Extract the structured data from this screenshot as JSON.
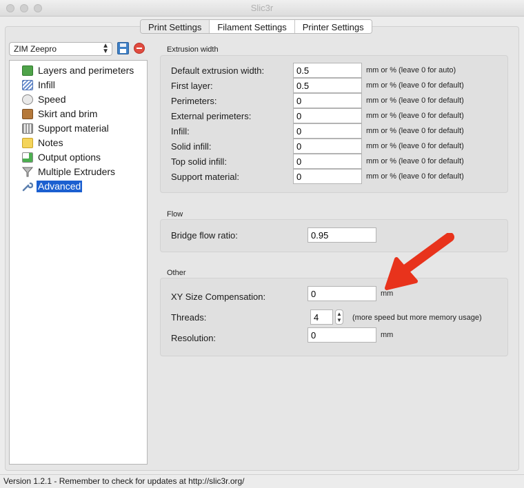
{
  "window": {
    "title": "Slic3r"
  },
  "tabs": [
    {
      "label": "Print Settings",
      "active": true
    },
    {
      "label": "Filament Settings",
      "active": false
    },
    {
      "label": "Printer Settings",
      "active": false
    }
  ],
  "preset": {
    "selected": "ZIM Zeepro"
  },
  "sidebar": {
    "items": [
      {
        "label": "Layers and perimeters",
        "icon": "layers-icon"
      },
      {
        "label": "Infill",
        "icon": "infill-icon"
      },
      {
        "label": "Speed",
        "icon": "speed-icon"
      },
      {
        "label": "Skirt and brim",
        "icon": "skirt-icon"
      },
      {
        "label": "Support material",
        "icon": "support-icon"
      },
      {
        "label": "Notes",
        "icon": "notes-icon"
      },
      {
        "label": "Output options",
        "icon": "output-icon"
      },
      {
        "label": "Multiple Extruders",
        "icon": "funnel-icon"
      },
      {
        "label": "Advanced",
        "icon": "wrench-icon",
        "selected": true
      }
    ]
  },
  "extrusion": {
    "title": "Extrusion width",
    "rows": [
      {
        "label": "Default extrusion width:",
        "value": "0.5",
        "suffix": "mm or % (leave 0 for auto)"
      },
      {
        "label": "First layer:",
        "value": "0.5",
        "suffix": "mm or % (leave 0 for default)"
      },
      {
        "label": "Perimeters:",
        "value": "0",
        "suffix": "mm or % (leave 0 for default)"
      },
      {
        "label": "External perimeters:",
        "value": "0",
        "suffix": "mm or % (leave 0 for default)"
      },
      {
        "label": "Infill:",
        "value": "0",
        "suffix": "mm or % (leave 0 for default)"
      },
      {
        "label": "Solid infill:",
        "value": "0",
        "suffix": "mm or % (leave 0 for default)"
      },
      {
        "label": "Top solid infill:",
        "value": "0",
        "suffix": "mm or % (leave 0 for default)"
      },
      {
        "label": "Support material:",
        "value": "0",
        "suffix": "mm or % (leave 0 for default)"
      }
    ]
  },
  "flow": {
    "title": "Flow",
    "bridge_label": "Bridge flow ratio:",
    "bridge_value": "0.95"
  },
  "other": {
    "title": "Other",
    "xy_label": "XY Size Compensation:",
    "xy_value": "0",
    "xy_suffix": "mm",
    "threads_label": "Threads:",
    "threads_value": "4",
    "threads_suffix": "(more speed but more memory usage)",
    "resolution_label": "Resolution:",
    "resolution_value": "0",
    "resolution_suffix": "mm"
  },
  "status": {
    "text": "Version 1.2.1 - Remember to check for updates at http://slic3r.org/"
  },
  "colors": {
    "selection": "#1b5fd0",
    "arrow": "#e8331c"
  }
}
